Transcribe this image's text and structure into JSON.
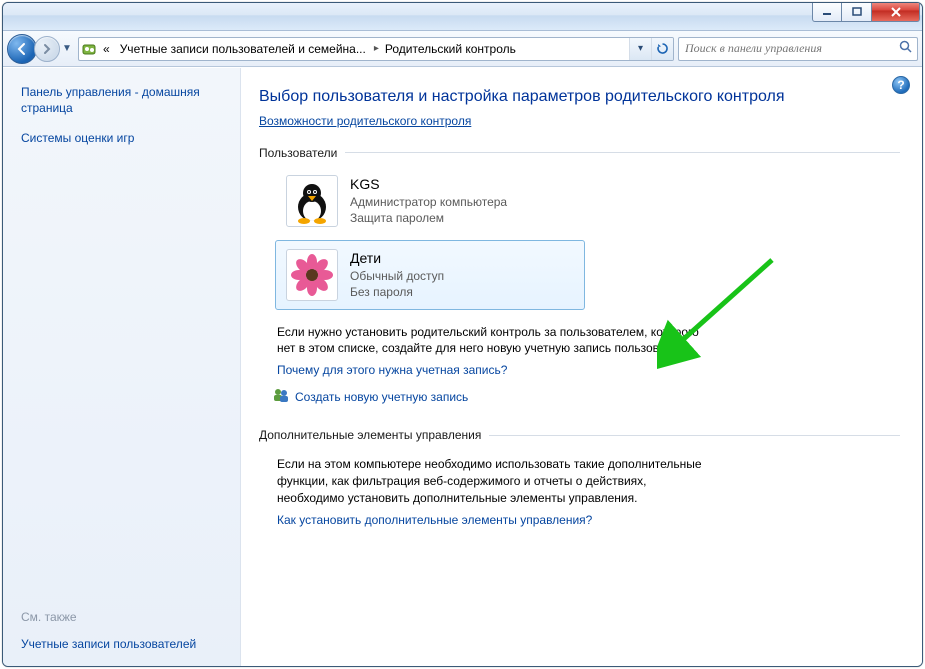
{
  "breadcrumb": {
    "prefix": "«",
    "segment1": "Учетные записи пользователей и семейна...",
    "segment2": "Родительский контроль"
  },
  "search": {
    "placeholder": "Поиск в панели управления"
  },
  "sidebar": {
    "home": "Панель управления - домашняя страница",
    "ratings": "Системы оценки игр",
    "see_also_label": "См. также",
    "user_accounts": "Учетные записи пользователей"
  },
  "main": {
    "heading": "Выбор пользователя и настройка параметров родительского контроля",
    "cap_link": "Возможности родительского контроля",
    "users_section": "Пользователи",
    "users": [
      {
        "name": "KGS",
        "role": "Администратор компьютера",
        "protection": "Защита паролем"
      },
      {
        "name": "Дети",
        "role": "Обычный доступ",
        "protection": "Без пароля"
      }
    ],
    "note_create": "Если нужно установить родительский контроль за пользователем, которого нет в этом списке, создайте для него новую учетную запись пользователя.",
    "why_link": "Почему для этого нужна учетная запись?",
    "create_link": "Создать новую учетную запись",
    "additional_section": "Дополнительные элементы управления",
    "additional_note": "Если на этом компьютере необходимо использовать такие дополнительные функции, как фильтрация веб-содержимого и отчеты о действиях, необходимо установить дополнительные элементы управления.",
    "additional_link": "Как установить дополнительные элементы управления?"
  }
}
